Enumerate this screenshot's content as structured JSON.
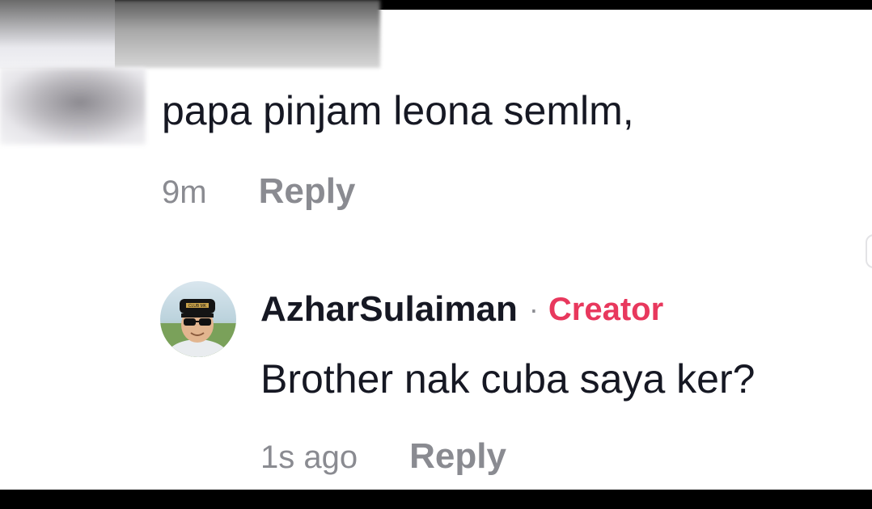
{
  "comment": {
    "text": "papa pinjam leona semlm,",
    "time": "9m",
    "reply_label": "Reply"
  },
  "creator_reply": {
    "username": "AzharSulaiman",
    "separator": "·",
    "badge": "Creator",
    "text": "Brother nak cuba saya ker?",
    "time": "1s ago",
    "reply_label": "Reply",
    "cap_text": "CLUB MK"
  },
  "colors": {
    "primary_text": "#161823",
    "secondary_text": "#8a8b91",
    "creator_badge": "#e8385d"
  }
}
